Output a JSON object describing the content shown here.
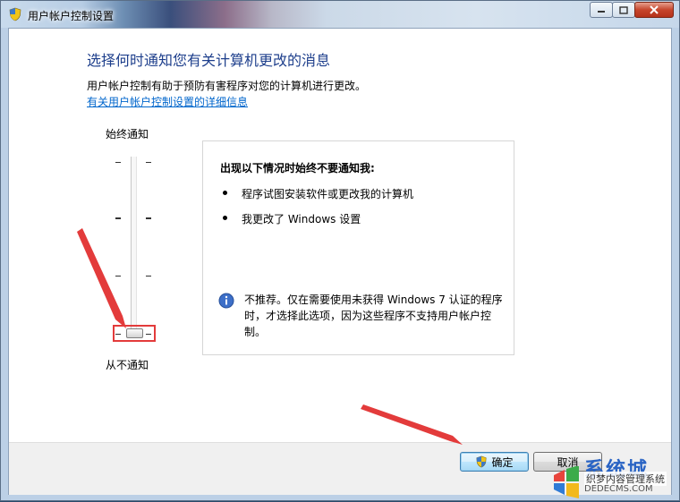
{
  "window": {
    "title": "用户帐户控制设置",
    "controls": {
      "minimize_icon": "minimize-icon",
      "maximize_icon": "maximize-icon",
      "close_icon": "close-icon"
    }
  },
  "main": {
    "heading": "选择何时通知您有关计算机更改的消息",
    "description": "用户帐户控制有助于预防有害程序对您的计算机进行更改。",
    "link": "有关用户帐户控制设置的详细信息"
  },
  "slider": {
    "top_label": "始终通知",
    "bottom_label": "从不通知",
    "levels": 4,
    "selected_level": 1
  },
  "info": {
    "title": "出现以下情况时始终不要通知我:",
    "bullets": [
      "程序试图安装软件或更改我的计算机",
      "我更改了 Windows 设置"
    ],
    "warning_icon": "info-icon",
    "warning_text": "不推荐。仅在需要使用未获得 Windows 7 认证的程序时，才选择此选项，因为这些程序不支持用户帐户控制。"
  },
  "footer": {
    "ok_label": "确定",
    "cancel_label": "取消"
  },
  "watermark": {
    "brand": "系统城",
    "subtitle": "织梦内容管理系统",
    "site": "DEDECMS.COM"
  },
  "colors": {
    "heading": "#1e3f8c",
    "link": "#0066cc",
    "annotation_red": "#e33b3b"
  }
}
